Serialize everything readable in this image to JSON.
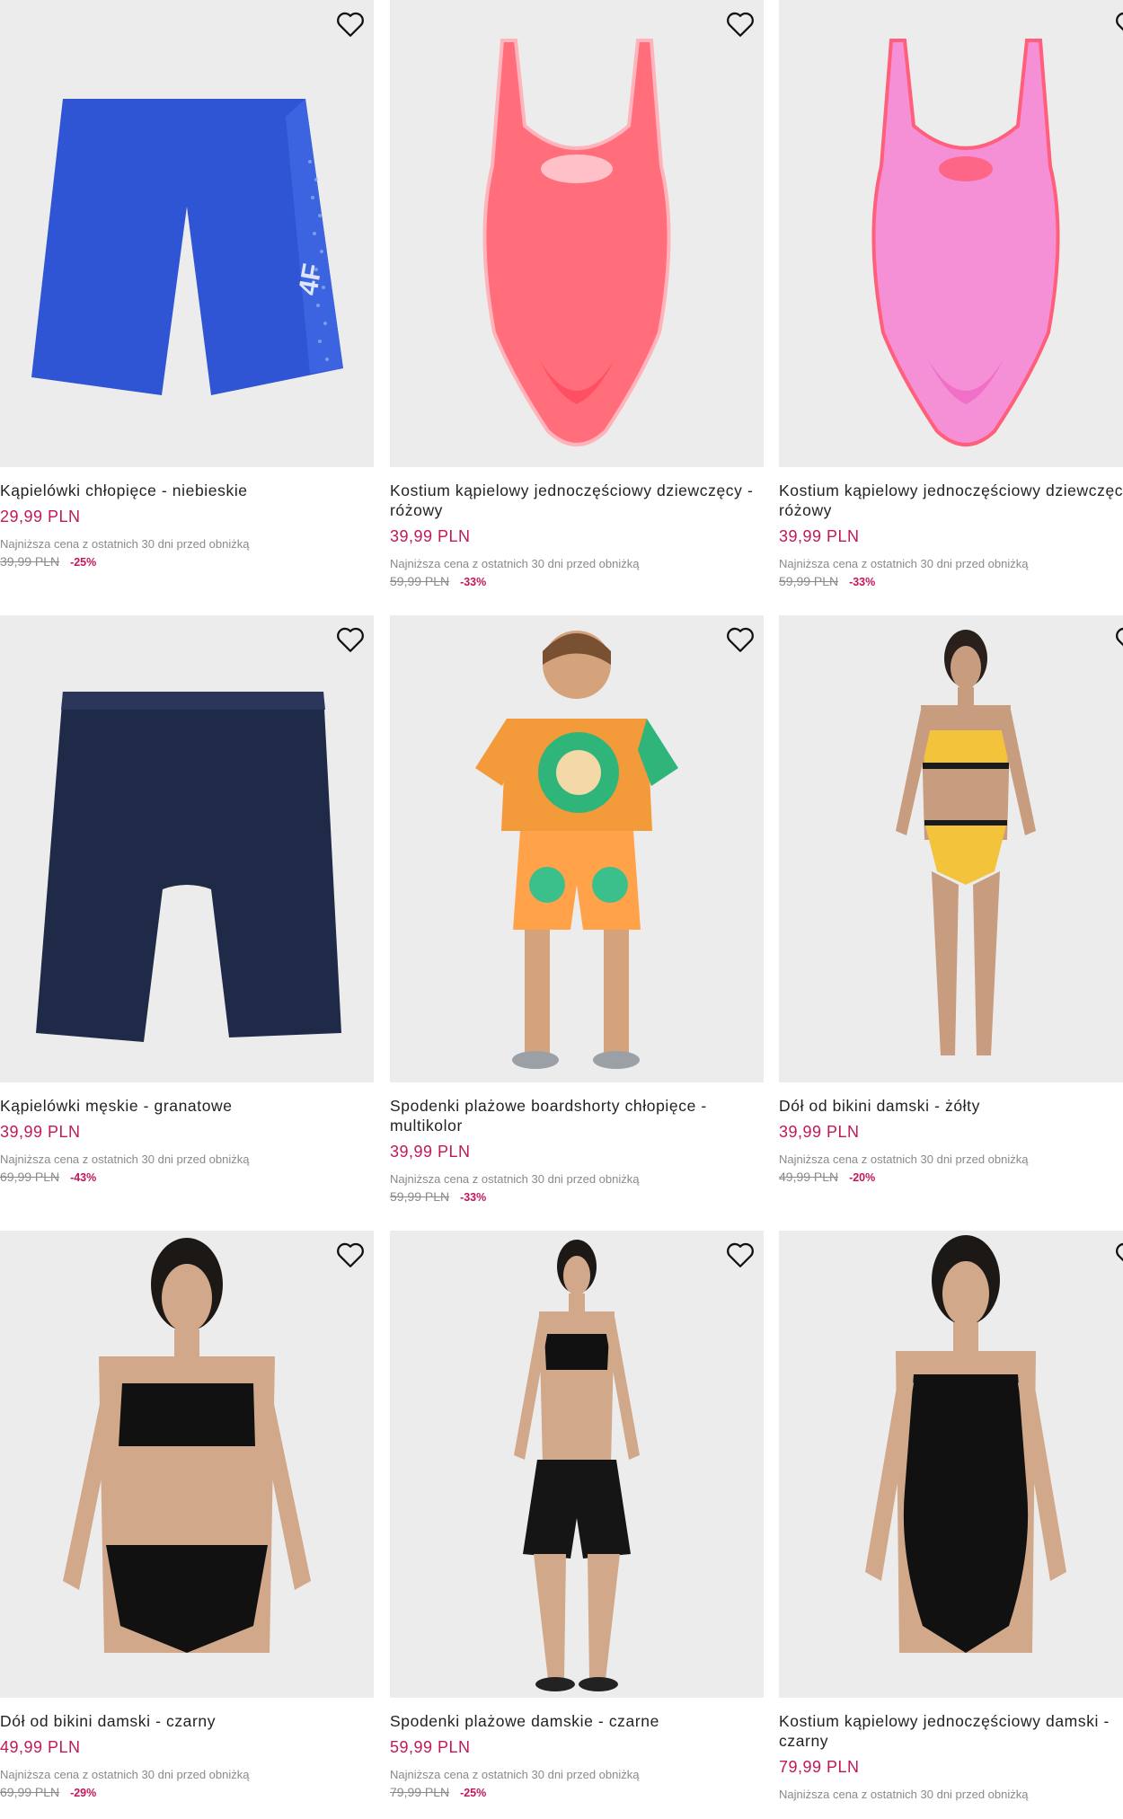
{
  "colors": {
    "price": "#c2185b",
    "image_bg": "#ececec",
    "muted": "#8a8a8a"
  },
  "products": [
    {
      "title": "Kąpielówki chłopięce - niebieskie",
      "price": "29,99 PLN",
      "lowest_label": "Najniższa cena z ostatnich 30 dni przed obniżką",
      "old_price": "39,99 PLN",
      "discount": "-25%",
      "icon": "heart-icon"
    },
    {
      "title": "Kostium kąpielowy jednoczęściowy dziewczęcy - różowy",
      "price": "39,99 PLN",
      "lowest_label": "Najniższa cena z ostatnich 30 dni przed obniżką",
      "old_price": "59,99 PLN",
      "discount": "-33%",
      "icon": "heart-icon"
    },
    {
      "title": "Kostium kąpielowy jednoczęściowy dziewczęcy - różowy",
      "price": "39,99 PLN",
      "lowest_label": "Najniższa cena z ostatnich 30 dni przed obniżką",
      "old_price": "59,99 PLN",
      "discount": "-33%",
      "icon": "heart-icon"
    },
    {
      "title": "Kąpielówki męskie - granatowe",
      "price": "39,99 PLN",
      "lowest_label": "Najniższa cena z ostatnich 30 dni przed obniżką",
      "old_price": "69,99 PLN",
      "discount": "-43%",
      "icon": "heart-icon"
    },
    {
      "title": "Spodenki plażowe boardshorty chłopięce - multikolor",
      "price": "39,99 PLN",
      "lowest_label": "Najniższa cena z ostatnich 30 dni przed obniżką",
      "old_price": "59,99 PLN",
      "discount": "-33%",
      "icon": "heart-icon"
    },
    {
      "title": "Dół od bikini damski - żółty",
      "price": "39,99 PLN",
      "lowest_label": "Najniższa cena z ostatnich 30 dni przed obniżką",
      "old_price": "49,99 PLN",
      "discount": "-20%",
      "icon": "heart-icon"
    },
    {
      "title": "Dół od bikini damski - czarny",
      "price": "49,99 PLN",
      "lowest_label": "Najniższa cena z ostatnich 30 dni przed obniżką",
      "old_price": "69,99 PLN",
      "discount": "-29%",
      "icon": "heart-icon"
    },
    {
      "title": "Spodenki plażowe damskie - czarne",
      "price": "59,99 PLN",
      "lowest_label": "Najniższa cena z ostatnich 30 dni przed obniżką",
      "old_price": "79,99 PLN",
      "discount": "-25%",
      "icon": "heart-icon"
    },
    {
      "title": "Kostium kąpielowy jednoczęściowy damski - czarny",
      "price": "79,99 PLN",
      "lowest_label": "Najniższa cena z ostatnich 30 dni przed obniżką",
      "old_price": "",
      "discount": "",
      "icon": "heart-icon"
    }
  ]
}
